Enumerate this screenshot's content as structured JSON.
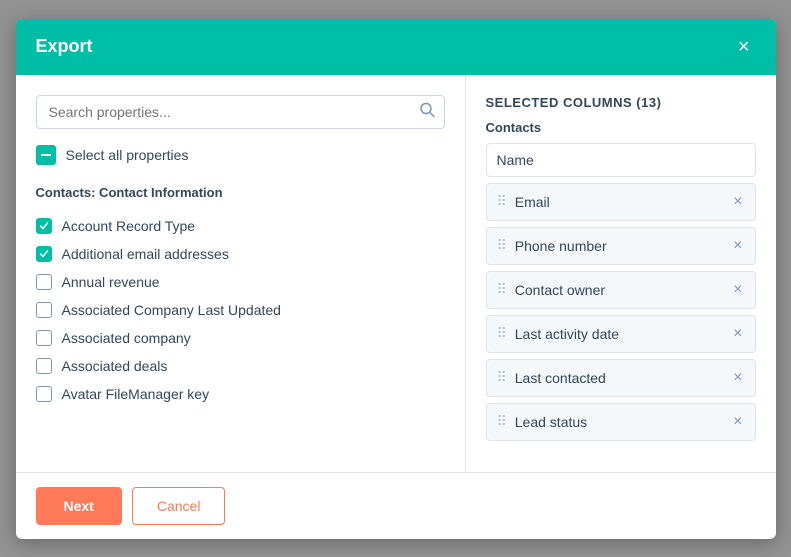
{
  "modal": {
    "title": "Export",
    "close_label": "×"
  },
  "search": {
    "placeholder": "Search properties..."
  },
  "select_all": {
    "label": "Select all properties"
  },
  "section": {
    "title": "Contacts: Contact Information"
  },
  "properties": [
    {
      "id": "account-record-type",
      "label": "Account Record Type",
      "checked": true
    },
    {
      "id": "additional-email",
      "label": "Additional email addresses",
      "checked": true
    },
    {
      "id": "annual-revenue",
      "label": "Annual revenue",
      "checked": false
    },
    {
      "id": "assoc-company-last-updated",
      "label": "Associated Company Last Updated",
      "checked": false
    },
    {
      "id": "assoc-company",
      "label": "Associated company",
      "checked": false
    },
    {
      "id": "assoc-deals",
      "label": "Associated deals",
      "checked": false
    },
    {
      "id": "avatar-filemanager",
      "label": "Avatar FileManager key",
      "checked": false
    }
  ],
  "selected_columns": {
    "header": "SELECTED COLUMNS (13)",
    "group_label": "Contacts",
    "items": [
      {
        "id": "name",
        "label": "Name",
        "removable": false
      },
      {
        "id": "email",
        "label": "Email",
        "removable": true
      },
      {
        "id": "phone-number",
        "label": "Phone number",
        "removable": true
      },
      {
        "id": "contact-owner",
        "label": "Contact owner",
        "removable": true
      },
      {
        "id": "last-activity-date",
        "label": "Last activity date",
        "removable": true
      },
      {
        "id": "last-contacted",
        "label": "Last contacted",
        "removable": true
      },
      {
        "id": "lead-status",
        "label": "Lead status",
        "removable": true
      }
    ]
  },
  "footer": {
    "next_label": "Next",
    "cancel_label": "Cancel"
  }
}
